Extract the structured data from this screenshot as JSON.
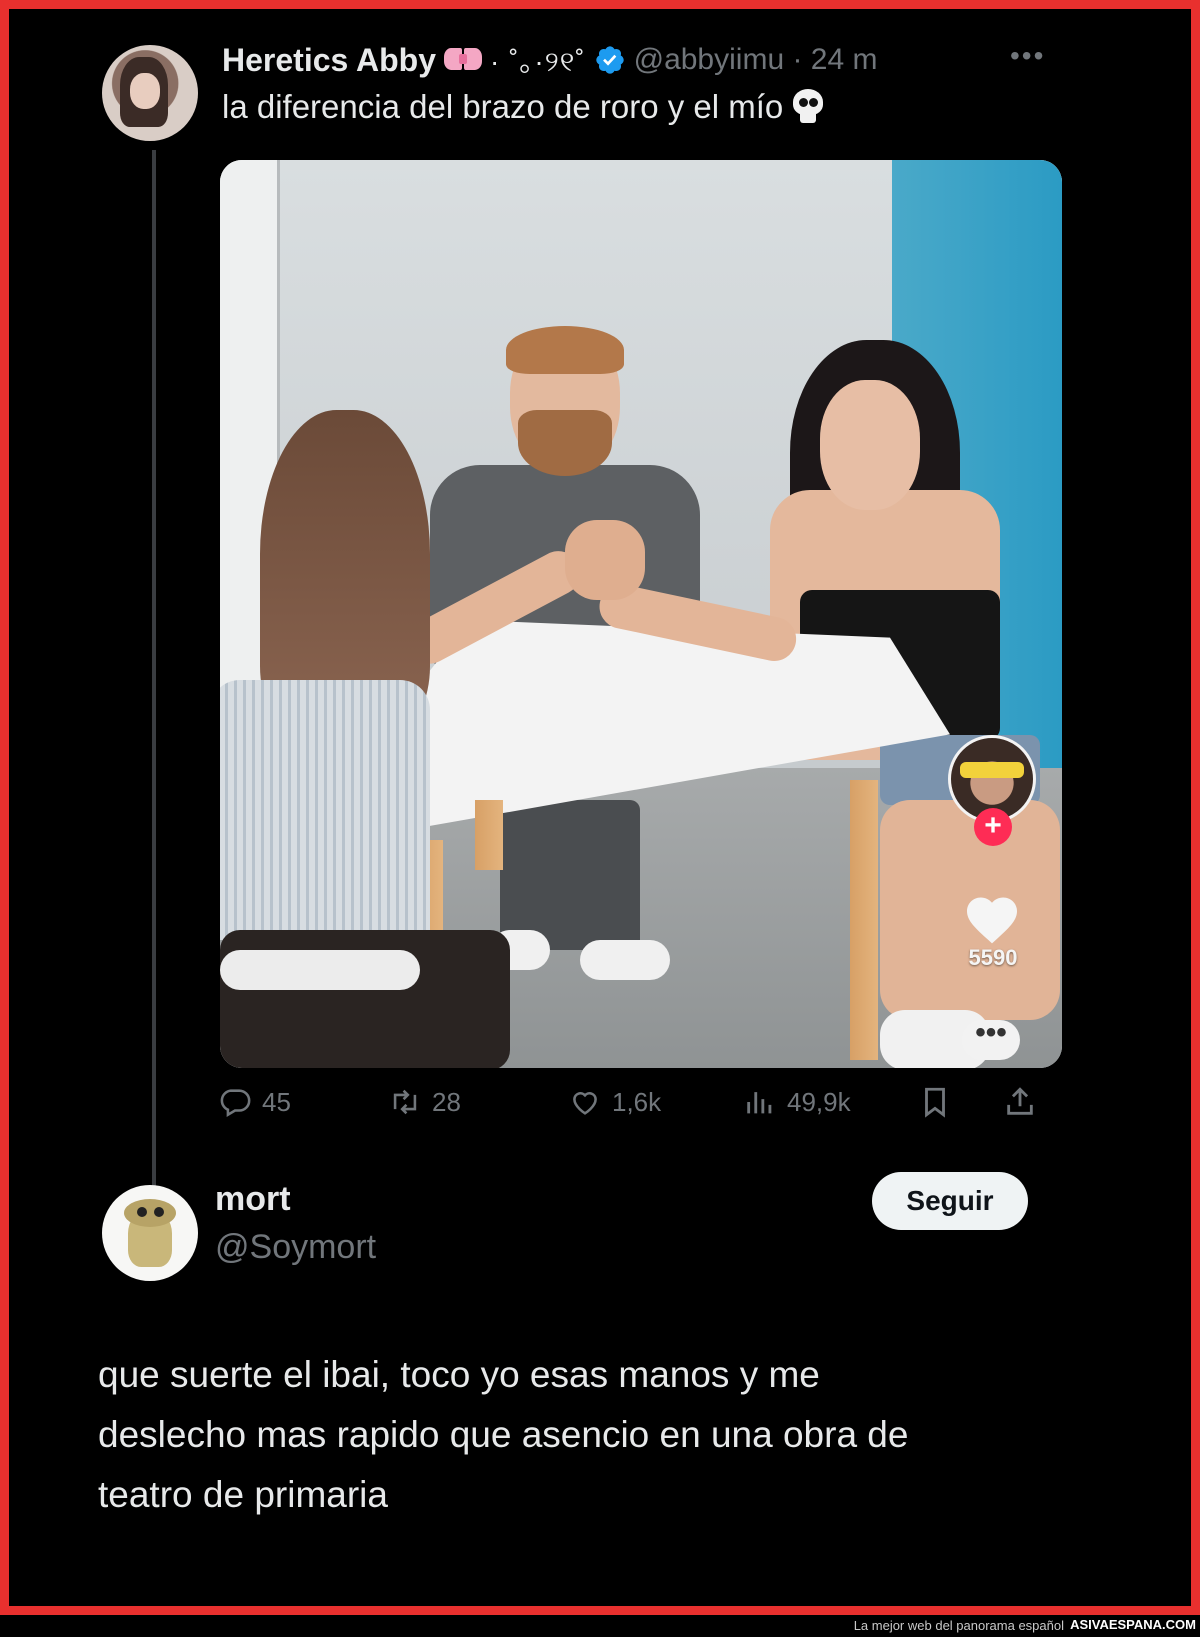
{
  "tweet": {
    "author_name": "Heretics Abby",
    "author_decoration": "· ˚｡·୨୧˚",
    "handle_time": "@abbyiimu · 24 m",
    "text": "la diferencia del brazo de roro y el mío",
    "more_icon": "more-dots-icon",
    "media": {
      "overlay_like_count": "5590",
      "overlay_plus": "+",
      "overlay_more": "•••"
    },
    "actions": {
      "replies": "45",
      "retweets": "28",
      "likes": "1,6k",
      "views": "49,9k"
    }
  },
  "reply": {
    "author_name": "mort",
    "handle": "@Soymort",
    "follow_label": "Seguir",
    "text_lines": [
      "que suerte el ibai, toco yo esas manos y me",
      "deslecho mas rapido que asencio en una obra de",
      "teatro de primaria"
    ]
  },
  "footer": {
    "tagline": "La mejor web del panorama español",
    "brand": "ASIVAESPANA.COM"
  },
  "colors": {
    "frame": "#e8302e",
    "background": "#000000",
    "text": "#e7e9ea",
    "muted": "#71767b",
    "verified": "#1d9bf0",
    "tiktok_red": "#fe2c55"
  }
}
